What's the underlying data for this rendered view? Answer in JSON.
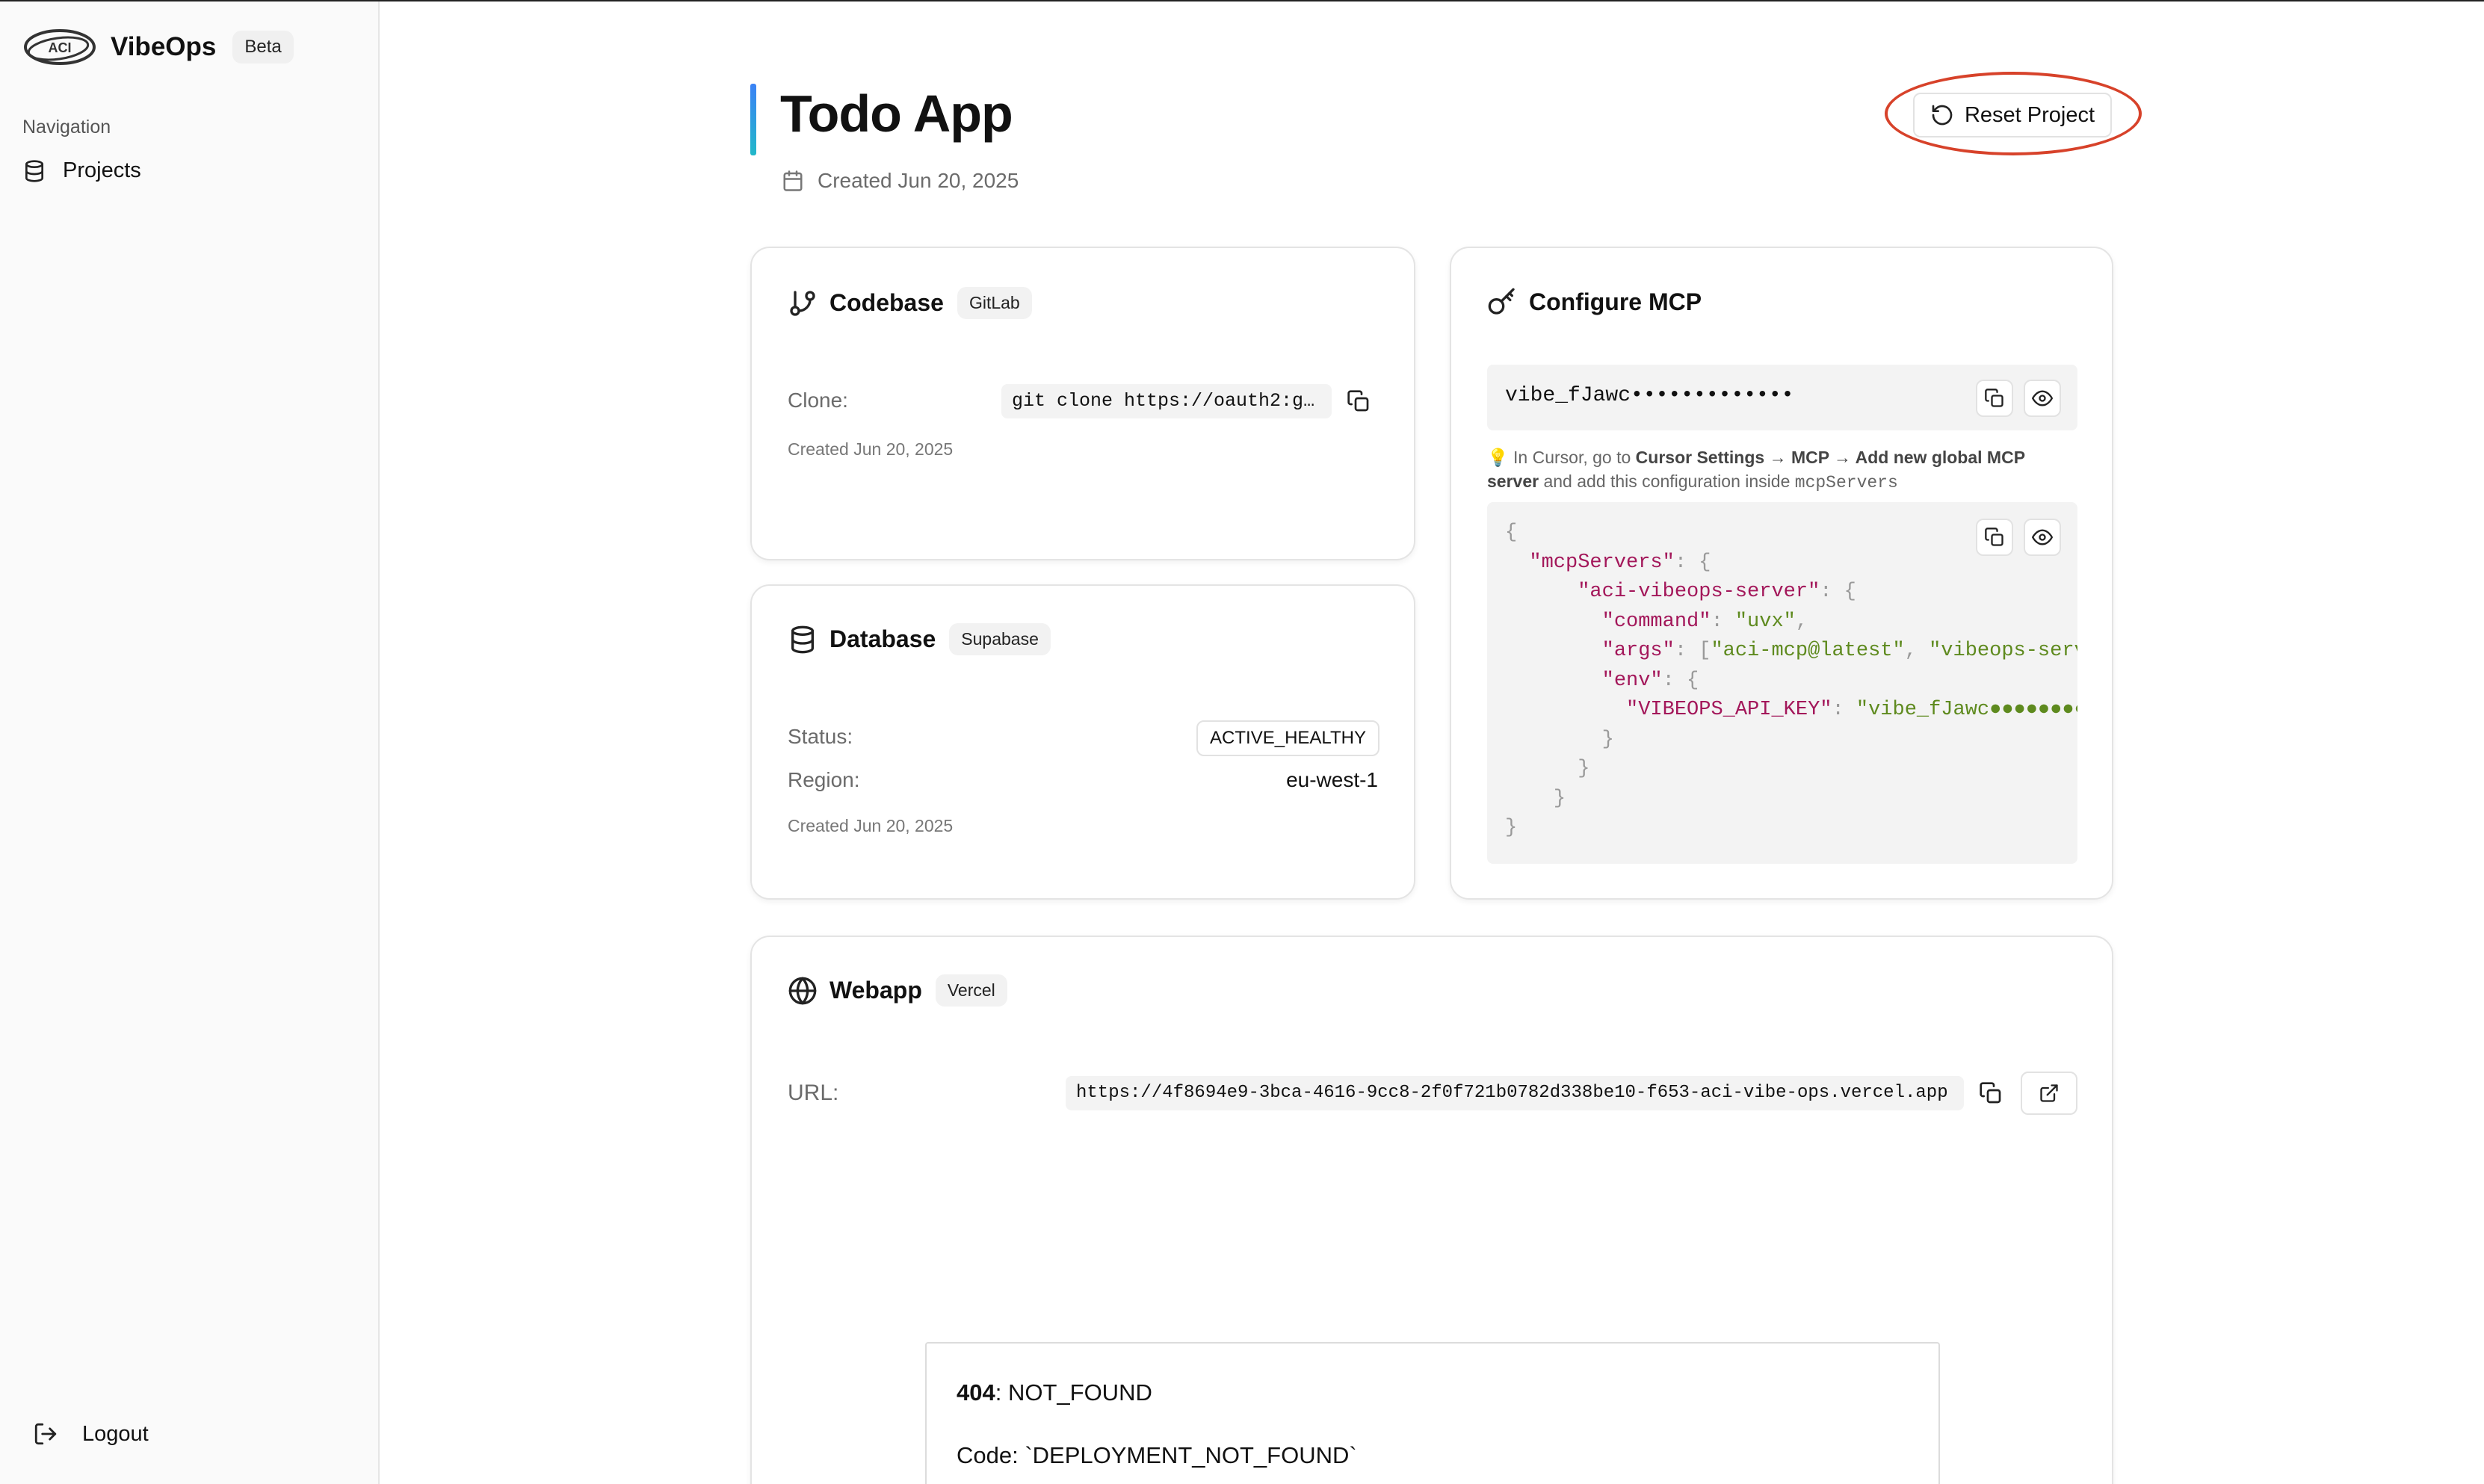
{
  "sidebar": {
    "brand": "VibeOps",
    "logo_text": "ACI",
    "beta": "Beta",
    "nav_label": "Navigation",
    "projects": "Projects",
    "logout": "Logout"
  },
  "header": {
    "title": "Todo App",
    "created": "Created Jun 20, 2025",
    "reset_label": "Reset Project"
  },
  "codebase": {
    "title": "Codebase",
    "provider": "GitLab",
    "clone_label": "Clone:",
    "clone_value": "git clone https://oauth2:gl…",
    "created": "Created Jun 20, 2025"
  },
  "database": {
    "title": "Database",
    "provider": "Supabase",
    "status_label": "Status:",
    "status_value": "ACTIVE_HEALTHY",
    "region_label": "Region:",
    "region_value": "eu-west-1",
    "created": "Created Jun 20, 2025"
  },
  "mcp": {
    "title": "Configure MCP",
    "key_masked": "vibe_fJawc•••••••••••••",
    "hint_emoji": "💡",
    "hint_pre": "In Cursor, go to",
    "hint_bold": "Cursor Settings → MCP → Add new global MCP server",
    "hint_mid": "and add this configuration inside",
    "hint_code": "mcpServers",
    "json": {
      "k_servers": "\"mcpServers\"",
      "k_server": "\"aci-vibeops-server\"",
      "k_command": "\"command\"",
      "v_command": "\"uvx\"",
      "k_args": "\"args\"",
      "v_arg1": "\"aci-mcp@latest\"",
      "v_arg2": "\"vibeops-server\"",
      "k_env": "\"env\"",
      "k_apikey": "\"VIBEOPS_API_KEY\"",
      "v_apikey": "\"vibe_fJawc●●●●●●●●●●●●●\""
    }
  },
  "webapp": {
    "title": "Webapp",
    "provider": "Vercel",
    "url_label": "URL:",
    "url_value": "https://4f8694e9-3bca-4616-9cc8-2f0f721b0782d338be10-f653-aci-vibe-ops.vercel.app",
    "error_code": "404",
    "error_text": ": NOT_FOUND",
    "error_line2": "Code: `DEPLOYMENT_NOT_FOUND`"
  },
  "colors": {
    "accent_start": "#3b82f6",
    "accent_end": "#22b8c9",
    "annotation": "#d7422a",
    "json_key": "#a3175a",
    "json_string": "#5e8a1e"
  },
  "icons": {
    "logo": "aci-logo-icon",
    "projects": "database-icon",
    "logout": "logout-icon",
    "calendar": "calendar-icon",
    "reset": "rotate-ccw-icon",
    "codebase": "git-branch-icon",
    "database": "database-icon",
    "mcp": "key-icon",
    "webapp": "globe-icon",
    "copy": "copy-icon",
    "eye": "eye-icon",
    "external": "external-link-icon"
  }
}
